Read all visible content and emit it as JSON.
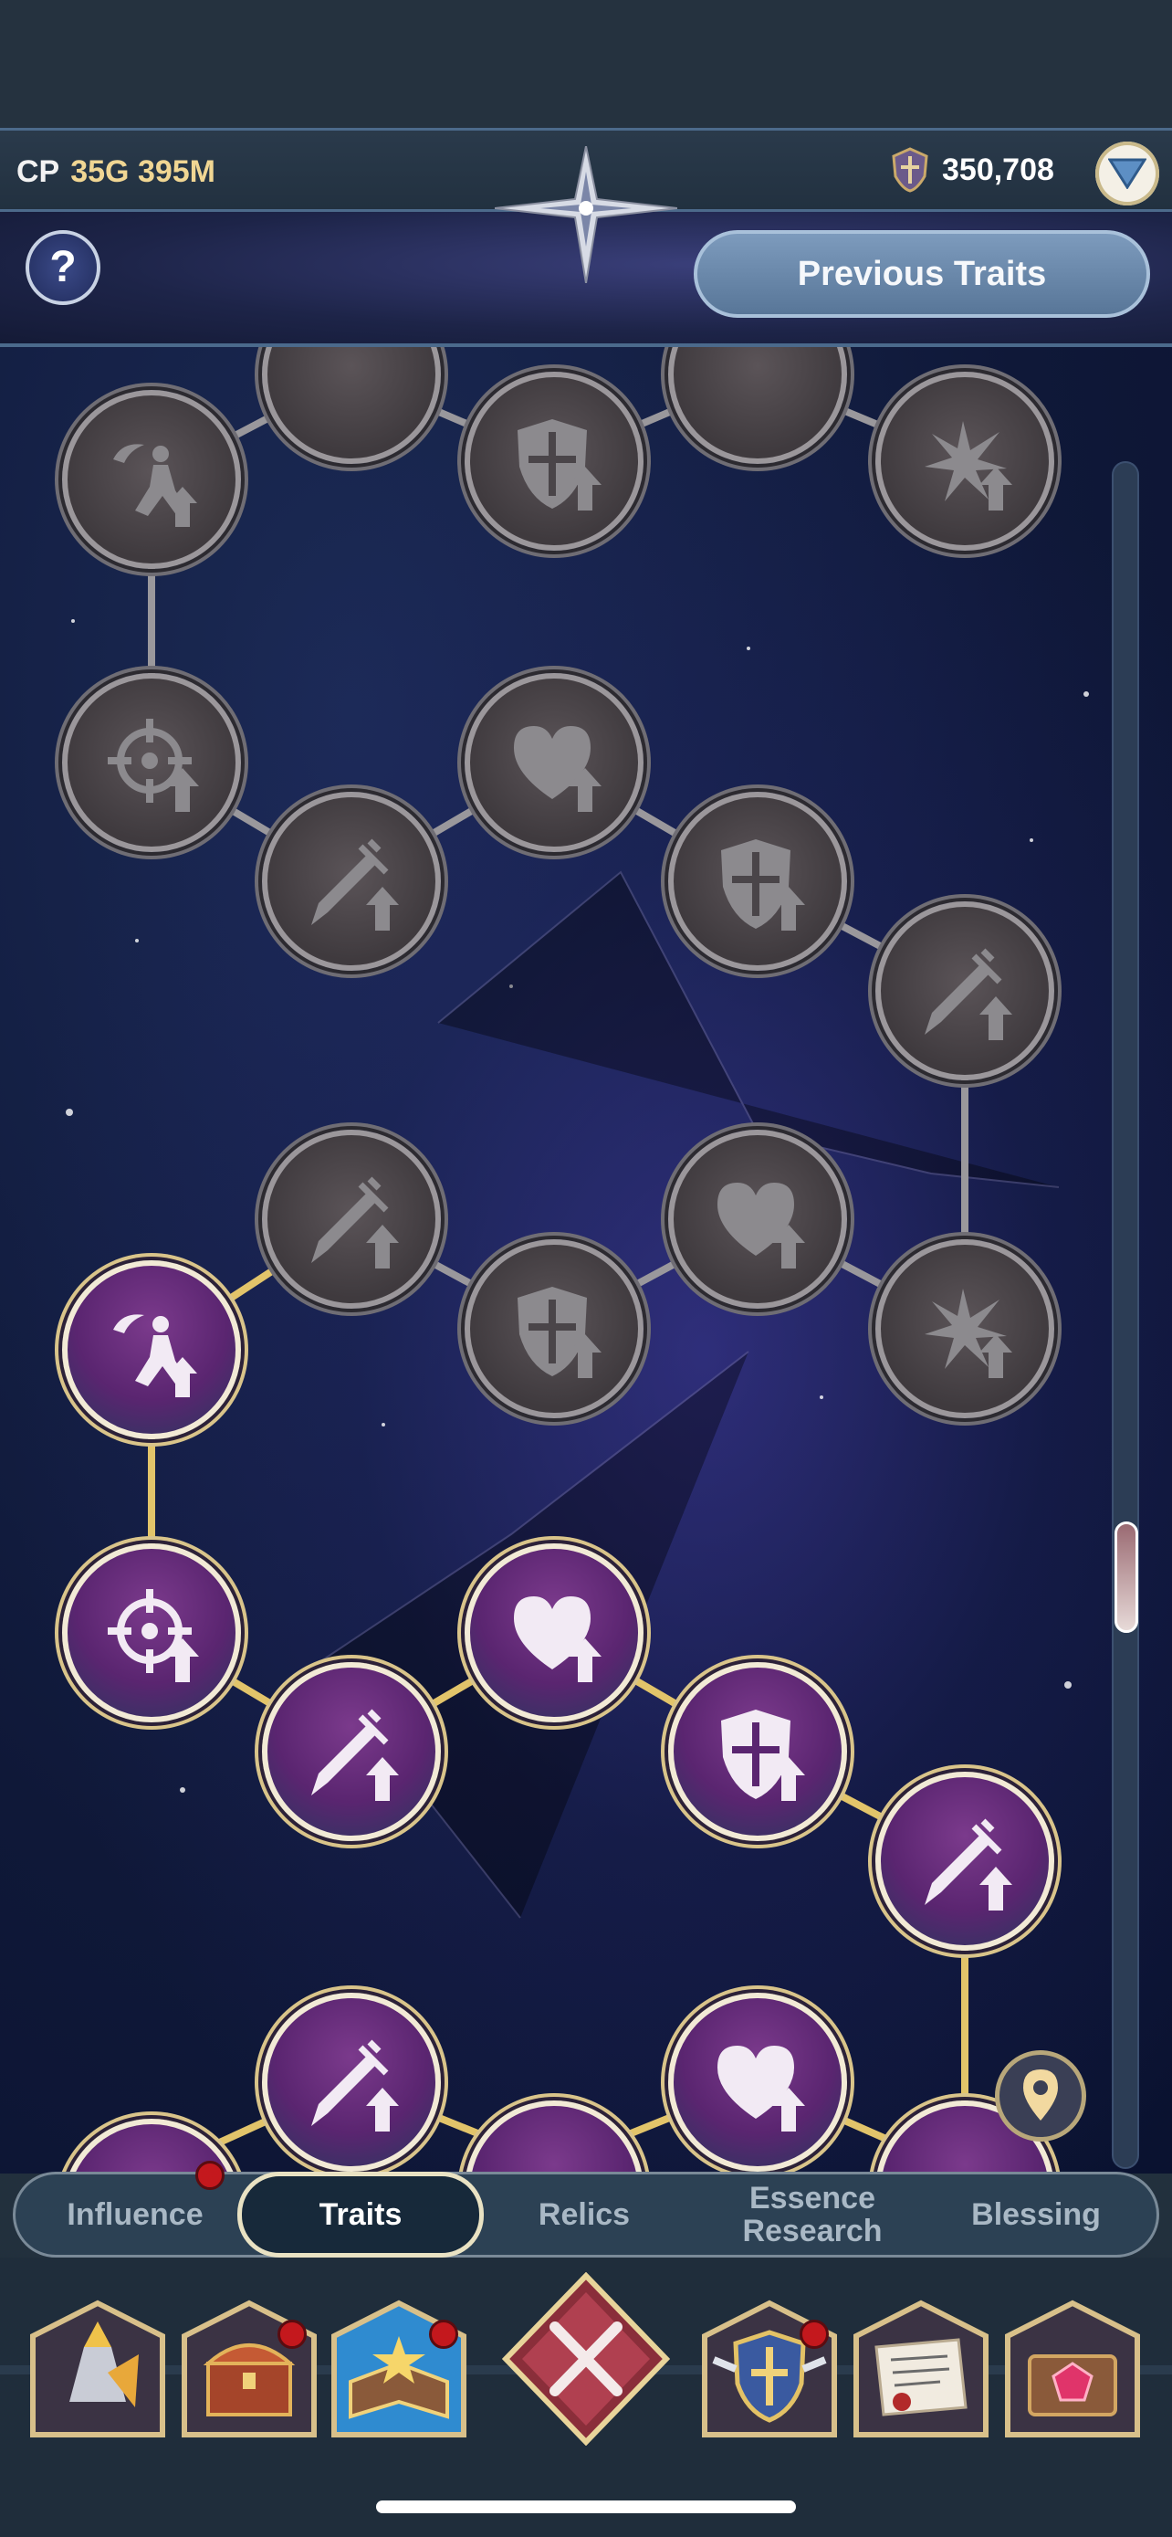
{
  "header": {
    "cp_label": "CP",
    "cp_value": "35G 395M",
    "currency_value": "350,708",
    "currency_icon": "shield-coin-icon",
    "dropdown_icon": "chevron-down-icon"
  },
  "subbar": {
    "help_label": "?",
    "previous_traits_label": "Previous Traits"
  },
  "colors": {
    "accent_gold": "#d9c48a",
    "active_node": "#5a2570",
    "locked_node": "#3f3a3e",
    "active_edge": "#e2c46a",
    "locked_edge": "#9a989c"
  },
  "trait_nodes": {
    "locked": [
      "skill-icon",
      "dodge-up-icon",
      "sword-up-icon",
      "shield-up-icon",
      "heart-up-icon",
      "crit-up-icon",
      "aim-up-icon"
    ],
    "active": [
      "dodge-up-icon",
      "aim-up-icon",
      "sword-up-icon",
      "heart-up-icon",
      "shield-up-icon"
    ]
  },
  "tabs": {
    "influence": "Influence",
    "traits": "Traits",
    "relics": "Relics",
    "essence": "Essence Research",
    "blessing": "Blessing"
  },
  "bottom_menu": [
    "hero-icon",
    "treasure-chest-icon",
    "spellbook-icon",
    "close-icon",
    "guild-shield-icon",
    "scroll-letter-icon",
    "gem-chest-icon"
  ]
}
